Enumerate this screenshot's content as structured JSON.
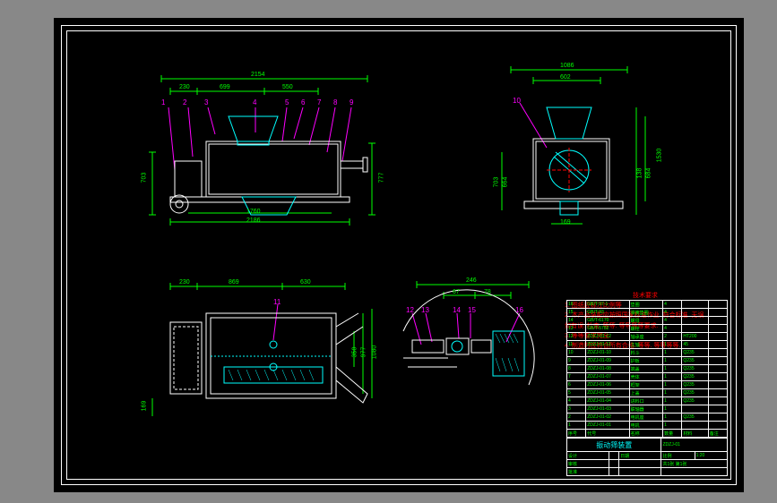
{
  "view1": {
    "balloons": [
      "1",
      "2",
      "3",
      "4",
      "5",
      "6",
      "7",
      "8",
      "9"
    ],
    "dims": {
      "overall_w": "2154",
      "d1": "230",
      "d2": "699",
      "d3": "550",
      "left_h": "703",
      "right_h": "777",
      "base_w": "2186",
      "inner_w": "1760"
    }
  },
  "view2": {
    "balloons": [
      "10"
    ],
    "dims": {
      "overall_w": "1086",
      "inner_w": "602",
      "right_h": "1530",
      "r1": "138",
      "r2": "684",
      "left_h": "703",
      "lb": "664",
      "bottom": "169"
    }
  },
  "view3": {
    "balloons": [
      "11"
    ],
    "dims": {
      "d1": "230",
      "d2": "869",
      "d3": "630",
      "h1": "977",
      "h2": "350",
      "h3": "1080",
      "left": "169"
    }
  },
  "view4": {
    "balloons": [
      "12",
      "13",
      "14",
      "15",
      "16"
    ],
    "dims": {
      "overall_w": "246",
      "d1": "67",
      "d2": "78"
    }
  },
  "notes": {
    "title": "技术要求",
    "line1": "1. 图纸应标注比例等",
    "line2": "2. 本产品装配应按照国家标准作业. 符合标准. 无误.",
    "line3": "   如有误. 检查. 等等. 等等等等要求.",
    "line4": "3. 等等要求完全.",
    "line5": "4. 制造时应符合所有合格. 等等. 等等等等."
  },
  "bom": {
    "rows": [
      {
        "n": "16",
        "id": "GB/T-97-1",
        "desc": "垫圈",
        "q": "4",
        "mat": "",
        "note": ""
      },
      {
        "n": "15",
        "id": "GB/T-93",
        "desc": "弹簧垫圈",
        "q": "4",
        "mat": "",
        "note": ""
      },
      {
        "n": "14",
        "id": "GB/T-6170",
        "desc": "螺母",
        "q": "4",
        "mat": "",
        "note": ""
      },
      {
        "n": "13",
        "id": "GB/T-5782",
        "desc": "螺栓",
        "q": "4",
        "mat": "",
        "note": ""
      },
      {
        "n": "12",
        "id": "ZDZJ-01-12",
        "desc": "轴承座",
        "q": "2",
        "mat": "HT200",
        "note": ""
      },
      {
        "n": "11",
        "id": "ZDZJ-01-11",
        "desc": "主轴",
        "q": "1",
        "mat": "45",
        "note": ""
      },
      {
        "n": "10",
        "id": "ZDZJ-01-10",
        "desc": "料斗",
        "q": "1",
        "mat": "Q235",
        "note": ""
      },
      {
        "n": "9",
        "id": "ZDZJ-01-09",
        "desc": "护板",
        "q": "1",
        "mat": "Q235",
        "note": ""
      },
      {
        "n": "8",
        "id": "ZDZJ-01-08",
        "desc": "端盖",
        "q": "1",
        "mat": "Q235",
        "note": ""
      },
      {
        "n": "7",
        "id": "ZDZJ-01-07",
        "desc": "壳体",
        "q": "1",
        "mat": "Q235",
        "note": ""
      },
      {
        "n": "6",
        "id": "ZDZJ-01-06",
        "desc": "框架",
        "q": "1",
        "mat": "Q235",
        "note": ""
      },
      {
        "n": "5",
        "id": "ZDZJ-01-05",
        "desc": "上盖",
        "q": "1",
        "mat": "Q235",
        "note": ""
      },
      {
        "n": "4",
        "id": "ZDZJ-01-04",
        "desc": "进料口",
        "q": "1",
        "mat": "Q235",
        "note": ""
      },
      {
        "n": "3",
        "id": "ZDZJ-01-03",
        "desc": "联轴器",
        "q": "1",
        "mat": "",
        "note": ""
      },
      {
        "n": "2",
        "id": "ZDZJ-01-02",
        "desc": "电机座",
        "q": "1",
        "mat": "Q235",
        "note": ""
      },
      {
        "n": "1",
        "id": "ZDZJ-01-01",
        "desc": "电机",
        "q": "1",
        "mat": "",
        "note": ""
      }
    ],
    "hdr": {
      "c1": "序号",
      "c2": "代号",
      "c3": "名称",
      "c4": "数量",
      "c5": "材料",
      "c6": "备注"
    }
  },
  "title_block": {
    "title": "振动筛装置",
    "dwg_no": "ZDZJ-01",
    "scale": "1:20",
    "sheet": "共1张 第1张",
    "design": "设计",
    "check": "审核",
    "appr": "批准",
    "date": "日期"
  }
}
